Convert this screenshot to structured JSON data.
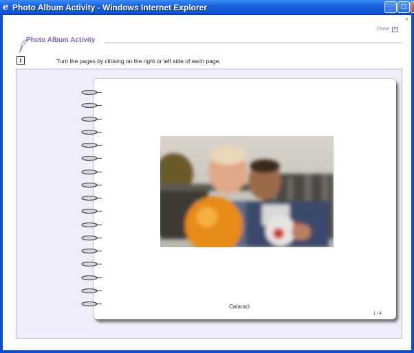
{
  "window": {
    "title": "Photo Album Activity - Windows Internet Explorer",
    "icon": "ie-icon",
    "controls": [
      "minimize-button",
      "maximize-button",
      "close-window-button"
    ]
  },
  "header": {
    "close_label": "Close",
    "close_icon": "close-box-icon",
    "title": "Photo Album Activity",
    "title_icon": "quill-icon",
    "info_icon": "info-icon",
    "instructions": "Turn the pages by clicking on the right or left side of each page."
  },
  "album": {
    "caption": "Cataract",
    "page_indicator": "1 / 4",
    "current_page": 1,
    "total_pages": 4,
    "ring_count": 17,
    "photo": "blurred-photo-two-children-with-balls"
  },
  "colors": {
    "accent": "#8060c8",
    "panel_background": "#f1ecfa",
    "titlebar": "#0a4fd2"
  }
}
